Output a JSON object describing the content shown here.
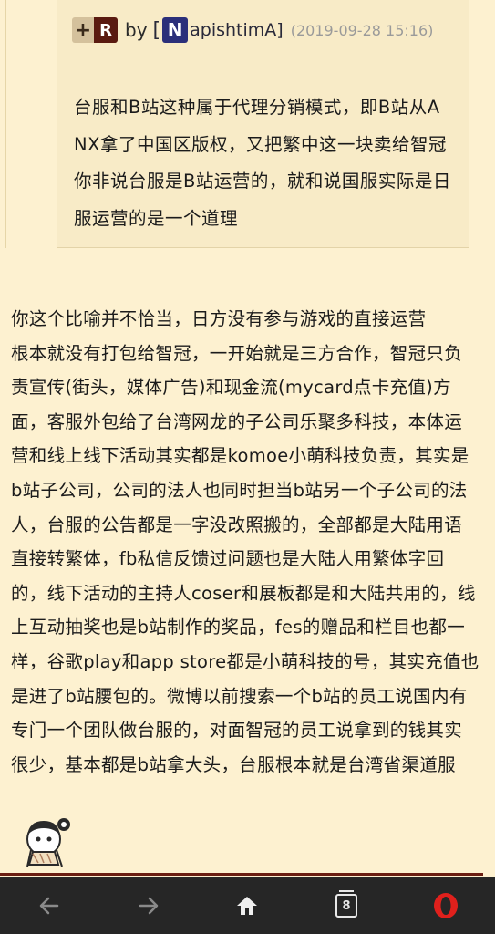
{
  "quote": {
    "badge_plus": "+",
    "badge_r": "R",
    "by": "by",
    "bracket_open": "[",
    "avatar_letter": "N",
    "username": "apishtimA]",
    "date": "(2019-09-28 15:16)",
    "lines": [
      "台服和B站这种属于代理分销模式，即B站从A",
      "NX拿了中国区版权，又把繁中这一块卖给智冠",
      "你非说台服是B站运营的，就和说国服实际是日",
      "服运营的是一个道理"
    ]
  },
  "reply": {
    "lines": [
      "你这个比喻并不恰当，日方没有参与游戏的直接运营",
      "根本就没有打包给智冠，一开始就是三方合作，智冠只负",
      "责宣传(街头，媒体广告)和现金流(mycard点卡充值)方",
      "面，客服外包给了台湾网龙的子公司乐聚多科技，本体运",
      "营和线上线下活动其实都是komoe小萌科技负责，其实是",
      "b站子公司，公司的法人也同时担当b站另一个子公司的法",
      "人，台服的公告都是一字没改照搬的，全部都是大陆用语",
      "直接转繁体，fb私信反馈过问题也是大陆人用繁体字回",
      "的，线下活动的主持人coser和展板都是和大陆共用的，线",
      "上互动抽奖也是b站制作的奖品，fes的赠品和栏目也都一",
      "样，谷歌play和app store都是小萌科技的号，其实充值也",
      "是进了b站腰包的。微博以前搜索一个b站的员工说国内有",
      "专门一个团队做台服的，对面智冠的员工说拿到的钱其实",
      "很少，基本都是b站拿大头，台服根本就是台湾省渠道服"
    ]
  },
  "navbar": {
    "tab_count": "8",
    "icons": [
      "back-arrow-icon",
      "forward-arrow-icon",
      "home-icon",
      "tabs-icon",
      "opera-icon"
    ]
  },
  "colors": {
    "background": "#fdf1d0",
    "quote_bg": "#f8ebc7",
    "navbar": "#262626",
    "opera_red": "#e0201c"
  }
}
